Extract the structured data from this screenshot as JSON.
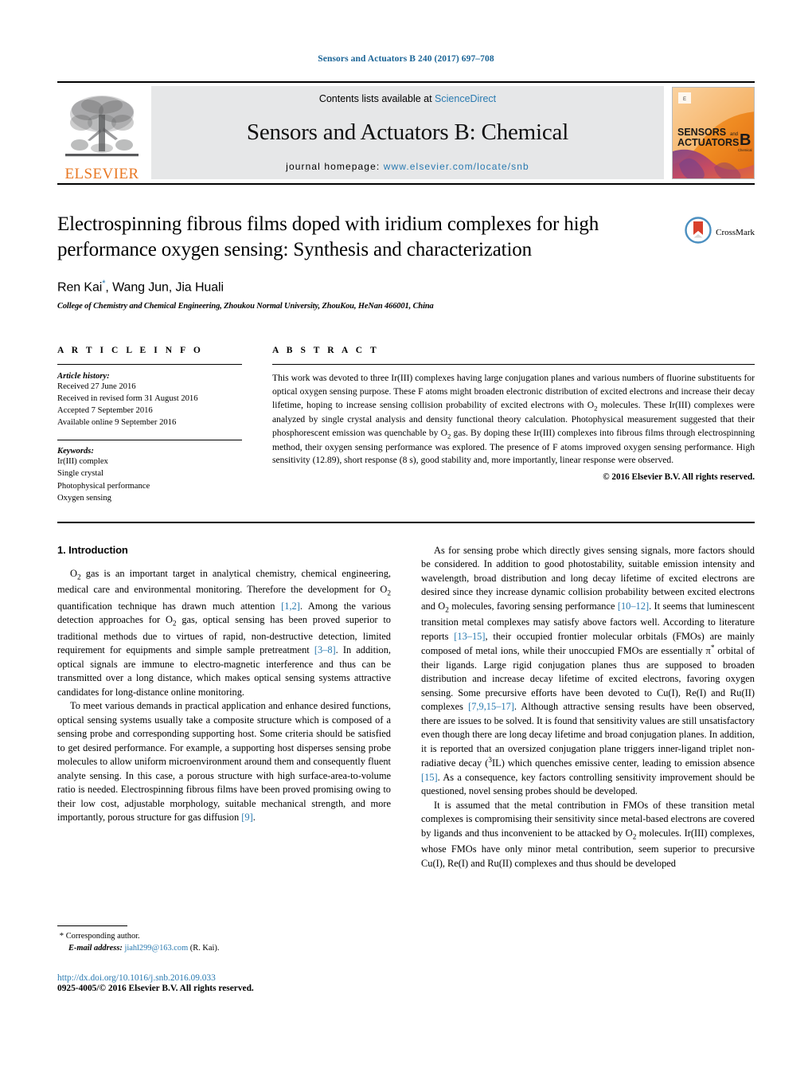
{
  "running_head": "Sensors and Actuators B 240 (2017) 697–708",
  "masthead": {
    "publisher_name": "ELSEVIER",
    "contents_prefix": "Contents lists available at ",
    "contents_link": "ScienceDirect",
    "journal_title": "Sensors and Actuators B: Chemical",
    "homepage_prefix": "journal homepage: ",
    "homepage_url": "www.elsevier.com/locate/snb",
    "cover_line1": "SENSORS",
    "cover_and": "and",
    "cover_line2": "ACTUATORS",
    "cover_letter": "B",
    "cover_sub": "Chemical",
    "link_color": "#2a7ab0",
    "elsevier_orange": "#E87722"
  },
  "article": {
    "title": "Electrospinning fibrous films doped with iridium complexes for high performance oxygen sensing: Synthesis and characterization",
    "authors": "Ren Kai",
    "author_marker": "*",
    "authors_rest": ", Wang Jun, Jia Huali",
    "affiliation": "College of Chemistry and Chemical Engineering, Zhoukou Normal University, ZhouKou, HeNan 466001, China",
    "crossmark_label": "CrossMark"
  },
  "article_info": {
    "heading": "A R T I C L E    I N F O",
    "history_label": "Article history:",
    "history": [
      "Received 27 June 2016",
      "Received in revised form 31 August 2016",
      "Accepted 7 September 2016",
      "Available online 9 September 2016"
    ],
    "keywords_label": "Keywords:",
    "keywords": [
      "Ir(III) complex",
      "Single crystal",
      "Photophysical performance",
      "Oxygen sensing"
    ]
  },
  "abstract": {
    "heading": "A B S T R A C T",
    "paragraph_parts": [
      "This work was devoted to three Ir(III) complexes having large conjugation planes and various numbers of fluorine substituents for optical oxygen sensing purpose. These F atoms might broaden electronic distribution of excited electrons and increase their decay lifetime, hoping to increase sensing collision probability of excited electrons with O",
      "2",
      " molecules. These Ir(III) complexes were analyzed by single crystal analysis and density functional theory calculation. Photophysical measurement suggested that their phosphorescent emission was quenchable by O",
      "2",
      " gas. By doping these Ir(III) complexes into fibrous films through electrospinning method, their oxygen sensing performance was explored. The presence of F atoms improved oxygen sensing performance. High sensitivity (12.89), short response (8 s), good stability and, more importantly, linear response were observed."
    ],
    "copyright": "© 2016 Elsevier B.V. All rights reserved."
  },
  "sections": {
    "intro_number_title": "1.  Introduction"
  },
  "left_column": {
    "p1": {
      "t1": "O",
      "sub1": "2",
      "t2": " gas is an important target in analytical chemistry, chemical engineering, medical care and environmental monitoring. Therefore the development for O",
      "sub2": "2",
      "t3": " quantification technique has drawn much attention ",
      "ref1": "[1,2]",
      "t4": ". Among the various detection approaches for O",
      "sub3": "2",
      "t5": " gas, optical sensing has been proved superior to traditional methods due to virtues of rapid, non-destructive detection, limited requirement for equipments and simple sample pretreatment ",
      "ref2": "[3–8]",
      "t6": ". In addition, optical signals are immune to electro-magnetic interference and thus can be transmitted over a long distance, which makes optical sensing systems attractive candidates for long-distance online monitoring."
    },
    "p2": {
      "t1": "To meet various demands in practical application and enhance desired functions, optical sensing systems usually take a composite structure which is composed of a sensing probe and corresponding supporting host. Some criteria should be satisfied to get desired performance. For example, a supporting host disperses sensing probe molecules to allow uniform microenvironment around them and consequently fluent analyte sensing. In this case, a porous structure with high surface-area-to-volume ratio is needed. Electrospinning fibrous films have been proved promising owing to their low cost, adjustable morphology, suitable mechanical strength, and more importantly, porous structure for gas diffusion ",
      "ref1": "[9]",
      "t2": "."
    }
  },
  "right_column": {
    "p1": {
      "t1": "As for sensing probe which directly gives sensing signals, more factors should be considered. In addition to good photostability, suitable emission intensity and wavelength, broad distribution and long decay lifetime of excited electrons are desired since they increase dynamic collision probability between excited electrons and O",
      "sub1": "2",
      "t2": " molecules, favoring sensing performance ",
      "ref1": "[10–12]",
      "t3": ". It seems that luminescent transition metal complexes may satisfy above factors well. According to literature reports ",
      "ref2": "[13–15]",
      "t4": ", their occupied frontier molecular orbitals (FMOs) are mainly composed of metal ions, while their unoccupied FMOs are essentially π",
      "sup1": "*",
      "t5": " orbital of their ligands. Large rigid conjugation planes thus are supposed to broaden distribution and increase decay lifetime of excited electrons, favoring oxygen sensing. Some precursive efforts have been devoted to Cu(I), Re(I) and Ru(II) complexes ",
      "ref3": "[7,9,15–17]",
      "t6": ". Although attractive sensing results have been observed, there are issues to be solved. It is found that sensitivity values are still unsatisfactory even though there are long decay lifetime and broad conjugation planes. In addition, it is reported that an oversized conjugation plane triggers inner-ligand triplet non-radiative decay (",
      "sup2": "3",
      "t7": "IL) which quenches emissive center, leading to emission absence ",
      "ref4": "[15]",
      "t8": ". As a consequence, key factors controlling sensitivity improvement should be questioned, novel sensing probes should be developed."
    },
    "p2": {
      "t1": "It is assumed that the metal contribution in FMOs of these transition metal complexes is compromising their sensitivity since metal-based electrons are covered by ligands and thus inconvenient to be attacked by O",
      "sub1": "2",
      "t2": " molecules. Ir(III) complexes, whose FMOs have only minor metal contribution, seem superior to precursive Cu(I), Re(I) and Ru(II) complexes and thus should be developed"
    }
  },
  "footer": {
    "corresponding_star": "*",
    "corresponding_text": "Corresponding author.",
    "email_label": "E-mail address:",
    "email": "jiahl299@163.com",
    "email_owner": "(R. Kai).",
    "doi": "http://dx.doi.org/10.1016/j.snb.2016.09.033",
    "issn_line": "0925-4005/© 2016 Elsevier B.V. All rights reserved."
  }
}
